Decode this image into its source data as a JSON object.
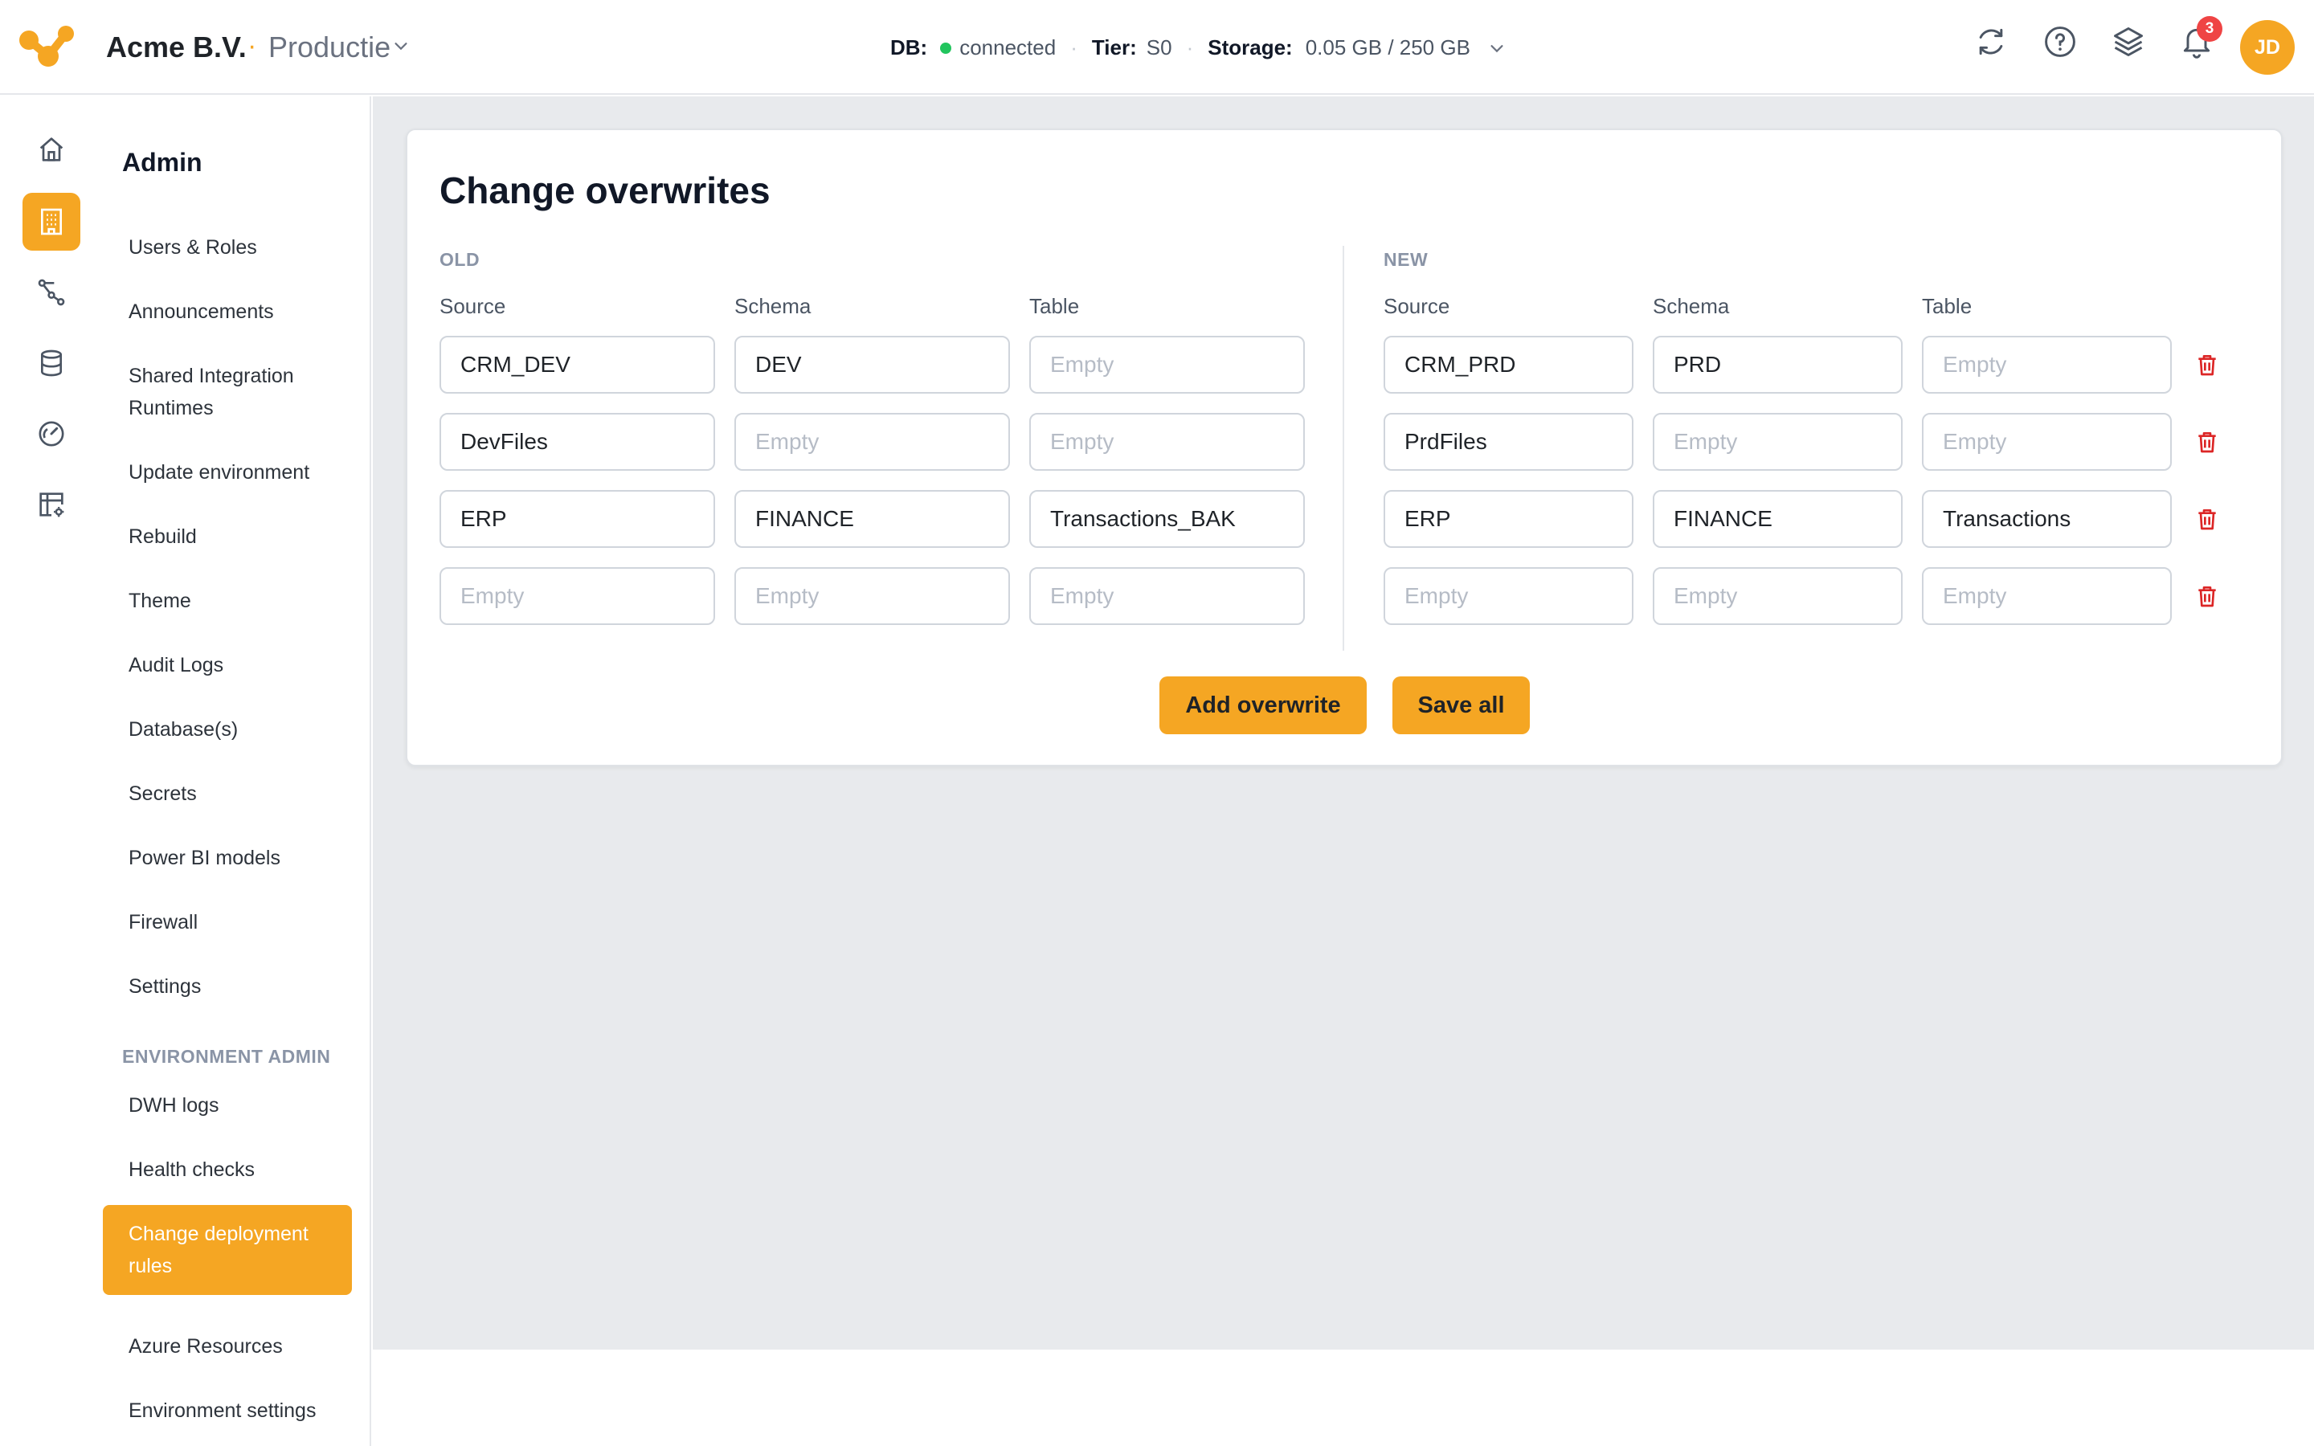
{
  "header": {
    "org": "Acme B.V.",
    "separator": "·",
    "environment": "Productie",
    "db_label": "DB:",
    "db_status": "connected",
    "tier_label": "Tier:",
    "tier_value": "S0",
    "storage_label": "Storage:",
    "storage_value": "0.05 GB / 250 GB",
    "notification_count": "3",
    "avatar_initials": "JD",
    "accent_color": "#f5a623",
    "status_color": "#22c55e"
  },
  "rail": {
    "items": [
      {
        "icon": "home-icon"
      },
      {
        "icon": "building-icon",
        "active": true
      },
      {
        "icon": "pipeline-icon"
      },
      {
        "icon": "database-icon"
      },
      {
        "icon": "gauge-icon"
      },
      {
        "icon": "table-settings-icon"
      }
    ]
  },
  "sidebar": {
    "title": "Admin",
    "items": [
      {
        "label": "Users & Roles"
      },
      {
        "label": "Announcements"
      },
      {
        "label": "Shared Integration Runtimes"
      },
      {
        "label": "Update environment"
      },
      {
        "label": "Rebuild"
      },
      {
        "label": "Theme"
      },
      {
        "label": "Audit Logs"
      },
      {
        "label": "Database(s)"
      },
      {
        "label": "Secrets"
      },
      {
        "label": "Power BI models"
      },
      {
        "label": "Firewall"
      },
      {
        "label": "Settings"
      }
    ],
    "section_title": "ENVIRONMENT ADMIN",
    "section_items": [
      {
        "label": "DWH logs"
      },
      {
        "label": "Health checks"
      },
      {
        "label": "Change deployment rules",
        "active": true
      },
      {
        "label": "Azure Resources"
      },
      {
        "label": "Environment settings"
      }
    ]
  },
  "card": {
    "title": "Change overwrites",
    "old_label": "OLD",
    "new_label": "NEW",
    "columns": {
      "source": "Source",
      "schema": "Schema",
      "table": "Table"
    },
    "placeholder": "Empty",
    "rows": [
      {
        "old_source": "CRM_DEV",
        "old_schema": "DEV",
        "old_table": "",
        "new_source": "CRM_PRD",
        "new_schema": "PRD",
        "new_table": ""
      },
      {
        "old_source": "DevFiles",
        "old_schema": "",
        "old_table": "",
        "new_source": "PrdFiles",
        "new_schema": "",
        "new_table": ""
      },
      {
        "old_source": "ERP",
        "old_schema": "FINANCE",
        "old_table": "Transactions_BAK",
        "new_source": "ERP",
        "new_schema": "FINANCE",
        "new_table": "Transactions"
      },
      {
        "old_source": "",
        "old_schema": "",
        "old_table": "",
        "new_source": "",
        "new_schema": "",
        "new_table": ""
      }
    ],
    "add_button": "Add overwrite",
    "save_button": "Save all",
    "delete_color": "#dc2626"
  }
}
